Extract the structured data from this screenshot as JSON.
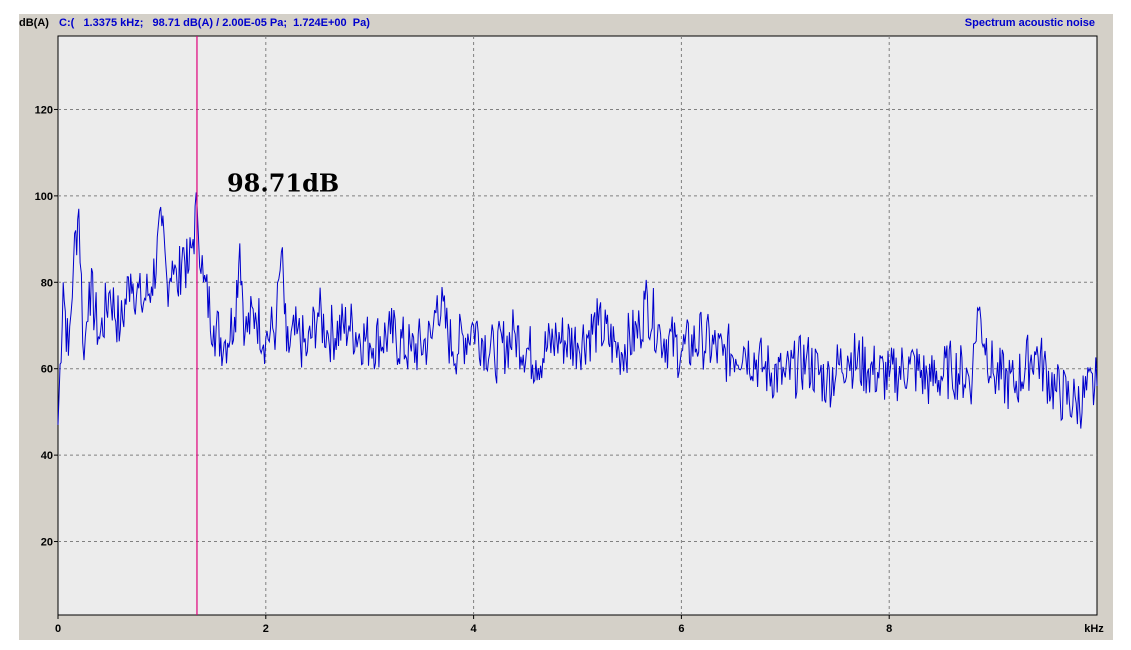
{
  "header": {
    "y_unit": "dB(A)",
    "cursor_readout": "C:(   1.3375 kHz;   98.71 dB(A) / 2.00E-05 Pa;  1.724E+00  Pa)",
    "title": "Spectrum acoustic noise"
  },
  "colors": {
    "series": "#0000cc",
    "cursor": "#e0007a",
    "plot_bg": "#ececec",
    "frame": "#d4d0c8",
    "grid": "#808080"
  },
  "chart_data": {
    "type": "line",
    "title": "Spectrum acoustic noise",
    "xlabel": "kHz",
    "ylabel": "dB(A)",
    "xlim": [
      0,
      10
    ],
    "ylim": [
      3,
      137
    ],
    "x_ticks": [
      "0",
      "2",
      "4",
      "6",
      "8",
      "kHz"
    ],
    "y_ticks": [
      "20",
      "40",
      "60",
      "80",
      "100",
      "120"
    ],
    "grid": true,
    "cursor_x": 1.3375,
    "annotation": "98.71dB",
    "series": [
      {
        "x": [
          0.0,
          0.05,
          0.1,
          0.15,
          0.2,
          0.25,
          0.3,
          0.4,
          0.5,
          0.6,
          0.7,
          0.8,
          0.9,
          1.0,
          1.05,
          1.1,
          1.15,
          1.2,
          1.25,
          1.3,
          1.34,
          1.4,
          1.5,
          1.6,
          1.7,
          1.75,
          1.8,
          1.9,
          2.0,
          2.1,
          2.15,
          2.2,
          2.3,
          2.4,
          2.5,
          2.6,
          2.8,
          3.0,
          3.2,
          3.4,
          3.6,
          3.65,
          3.8,
          4.0,
          4.2,
          4.4,
          4.6,
          4.8,
          5.0,
          5.2,
          5.4,
          5.6,
          5.65,
          5.8,
          6.0,
          6.2,
          6.4,
          6.6,
          6.8,
          7.0,
          7.2,
          7.4,
          7.6,
          7.8,
          8.0,
          8.2,
          8.4,
          8.6,
          8.8,
          8.85,
          9.0,
          9.2,
          9.4,
          9.6,
          9.8,
          10.0
        ],
        "y": [
          47,
          80,
          63,
          85,
          97,
          62,
          80,
          67,
          78,
          69,
          82,
          75,
          79,
          93,
          80,
          85,
          78,
          88,
          82,
          90,
          97,
          80,
          70,
          66,
          72,
          89,
          68,
          73,
          67,
          70,
          87,
          64,
          68,
          64,
          73,
          68,
          70,
          66,
          68,
          64,
          67,
          77,
          64,
          70,
          63,
          68,
          62,
          67,
          66,
          70,
          64,
          69,
          76,
          68,
          64,
          67,
          63,
          65,
          60,
          58,
          62,
          57,
          63,
          60,
          58,
          61,
          57,
          60,
          58,
          74,
          59,
          56,
          64,
          55,
          52,
          56
        ]
      }
    ]
  }
}
